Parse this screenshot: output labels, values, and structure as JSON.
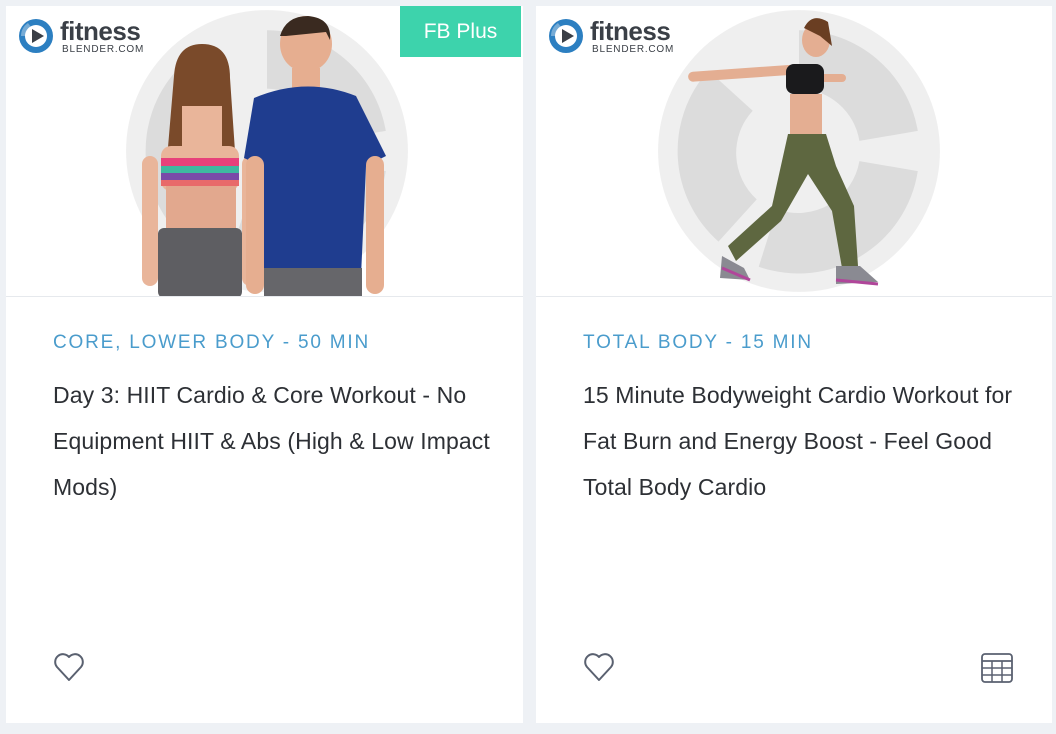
{
  "cards": [
    {
      "logo": {
        "word": "fitness",
        "sub": "BLENDER.COM"
      },
      "badge": "FB Plus",
      "tagline": "CORE, LOWER BODY - 50 MIN",
      "title": "Day 3: HIIT Cardio & Core Workout - No Equipment HIIT & Abs (High & Low Impact Mods)",
      "favorite_icon": "heart-outline-icon"
    },
    {
      "logo": {
        "word": "fitness",
        "sub": "BLENDER.COM"
      },
      "tagline": "TOTAL BODY - 15 MIN",
      "title": "15 Minute Bodyweight Cardio Workout for Fat Burn and Energy Boost - Feel Good Total Body Cardio",
      "favorite_icon": "heart-outline-icon",
      "calendar_icon": "calendar-icon"
    }
  ],
  "colors": {
    "badge": "#3dd3ac",
    "tagline": "#4a9ccc",
    "title": "#2d3035",
    "brand_blue": "#2c7fc1",
    "page_bg": "#eef1f5"
  }
}
